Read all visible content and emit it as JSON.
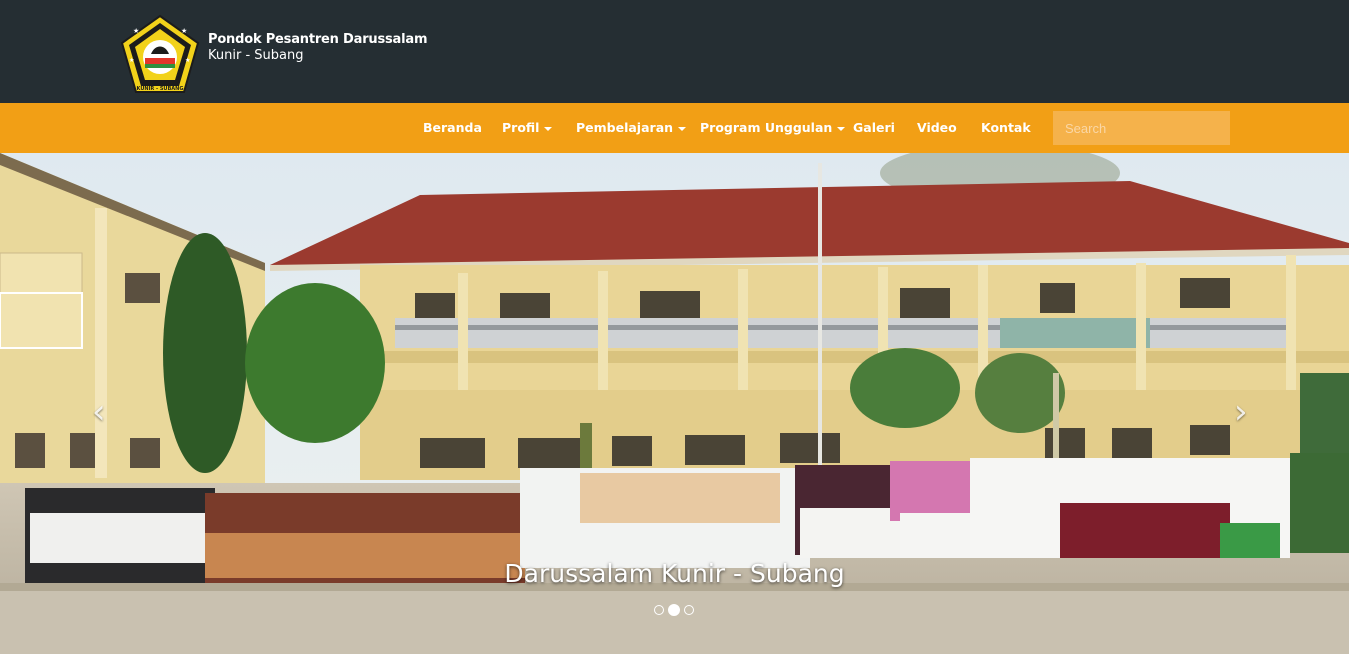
{
  "header": {
    "site_name": "Pondok Pesantren Darussalam",
    "location": "Kunir - Subang",
    "logo_text": "KUNIR - SUBANG",
    "logo_colors": {
      "outer": "#f2d21a",
      "inner": "#1c1c1c",
      "star": "#ffffff"
    }
  },
  "nav": {
    "items": [
      {
        "label": "Beranda",
        "dropdown": false
      },
      {
        "label": "Profil",
        "dropdown": true
      },
      {
        "label": "Pembelajaran",
        "dropdown": true
      },
      {
        "label": "Program Unggulan",
        "dropdown": true
      },
      {
        "label": "Galeri",
        "dropdown": false
      },
      {
        "label": "Video",
        "dropdown": false
      },
      {
        "label": "Kontak",
        "dropdown": false
      }
    ],
    "search_placeholder": "Search"
  },
  "carousel": {
    "caption": "Darussalam Kunir - Subang",
    "slide_count": 3,
    "active_index": 1,
    "prev_icon": "chevron-left-icon",
    "next_icon": "chevron-right-icon"
  },
  "colors": {
    "header_bg": "#252e33",
    "nav_bg": "#f29f15",
    "search_bg": "#f5b24b"
  }
}
